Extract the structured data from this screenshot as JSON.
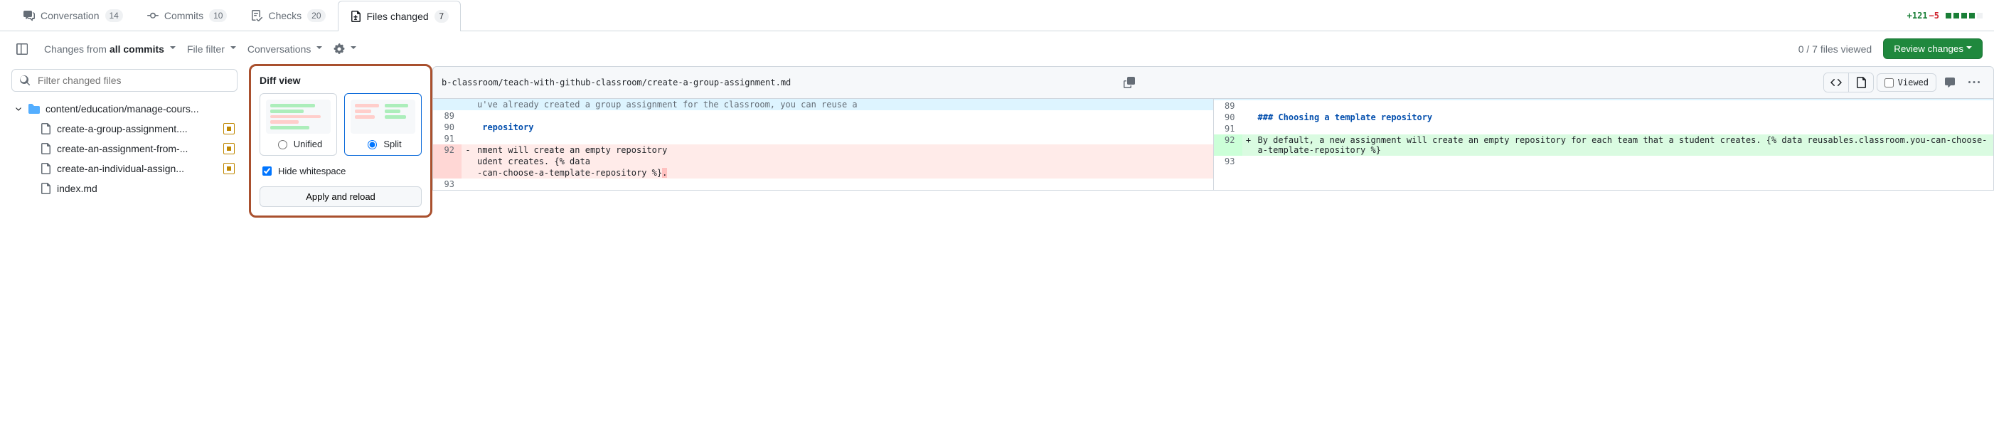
{
  "tabs": {
    "conversation": {
      "label": "Conversation",
      "count": "14"
    },
    "commits": {
      "label": "Commits",
      "count": "10"
    },
    "checks": {
      "label": "Checks",
      "count": "20"
    },
    "files": {
      "label": "Files changed",
      "count": "7"
    }
  },
  "diffstat": {
    "additions": "+121",
    "deletions": "−5"
  },
  "toolbar": {
    "changes_prefix": "Changes from ",
    "changes_scope": "all commits",
    "file_filter": "File filter",
    "conversations": "Conversations",
    "viewed_progress": "0 / 7 files viewed",
    "review_changes": "Review changes"
  },
  "popover": {
    "title": "Diff view",
    "unified": "Unified",
    "split": "Split",
    "hide_ws": "Hide whitespace",
    "apply": "Apply and reload"
  },
  "filter_placeholder": "Filter changed files",
  "tree": {
    "folder": "content/education/manage-cours...",
    "files": [
      {
        "name": "create-a-group-assignment....",
        "modified": true
      },
      {
        "name": "create-an-assignment-from-...",
        "modified": true
      },
      {
        "name": "create-an-individual-assign...",
        "modified": true
      },
      {
        "name": "index.md",
        "modified": false
      }
    ]
  },
  "file_header": {
    "path": "b-classroom/teach-with-github-classroom/create-a-group-assignment.md",
    "viewed": "Viewed"
  },
  "diff": {
    "hunk_prefix": "u've already created a group assignment for the classroom, you can reuse a",
    "left": {
      "l89": "89",
      "l90": "90",
      "l91": "91",
      "l92": "92",
      "l93": "93",
      "heading_suffix": " repository",
      "del_line1": "nment will create an empty repository",
      "del_line2_a": "udent creates. {% data",
      "del_line3": "-can-choose-a-template-repository %}",
      "del_char": "."
    },
    "right": {
      "l89": "89",
      "l90": "90",
      "l91": "91",
      "l92": "92",
      "l93": "93",
      "heading": "### Choosing a template repository",
      "add_line1": "By default, a new assignment will create an empty repository for each team that a student creates. {% data reusables.classroom.you-can-choose-a-template-repository %}"
    }
  }
}
